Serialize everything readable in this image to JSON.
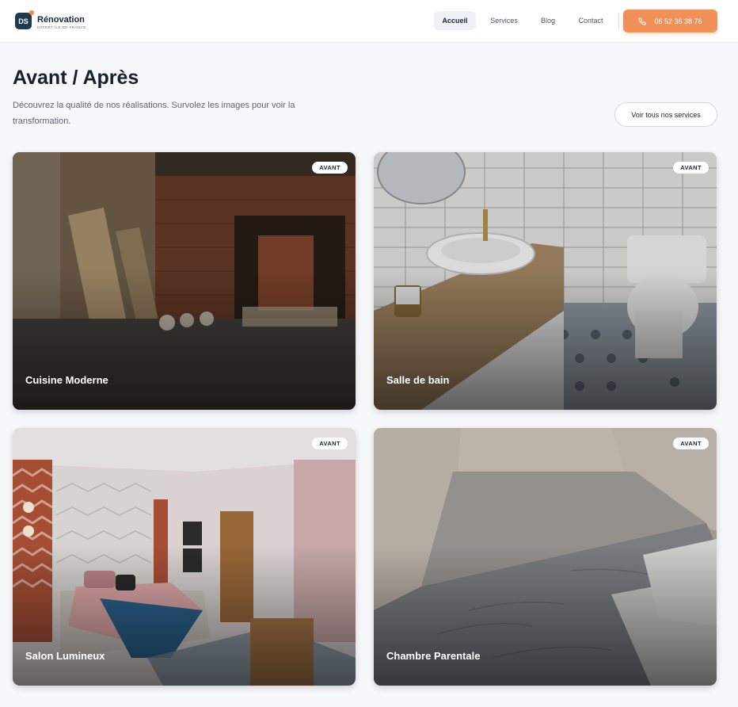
{
  "brand": {
    "badge": "DS",
    "title": "Rénovation",
    "subtitle": "EXPERT ÎLE-DE-FRANCE",
    "accent": "#f0915a"
  },
  "nav": {
    "items": [
      {
        "label": "Accueil",
        "active": true
      },
      {
        "label": "Services",
        "active": false
      },
      {
        "label": "Blog",
        "active": false
      },
      {
        "label": "Contact",
        "active": false
      }
    ],
    "phone": "06 52 36 38 76",
    "phone_icon": "phone-icon"
  },
  "page": {
    "title": "Avant / Après",
    "description": "Découvrez la qualité de nos réalisations. Survolez les images pour voir la transformation.",
    "services_button": "Voir tous nos services"
  },
  "gallery": [
    {
      "title": "Cuisine Moderne",
      "badge": "AVANT"
    },
    {
      "title": "Salle de bain",
      "badge": "AVANT"
    },
    {
      "title": "Salon Lumineux",
      "badge": "AVANT"
    },
    {
      "title": "Chambre Parentale",
      "badge": "AVANT"
    }
  ]
}
